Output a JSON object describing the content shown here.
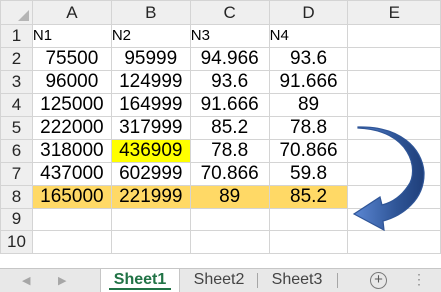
{
  "columns": [
    "A",
    "B",
    "C",
    "D",
    "E"
  ],
  "rows": [
    "1",
    "2",
    "3",
    "4",
    "5",
    "6",
    "7",
    "8",
    "9",
    "10"
  ],
  "headers": [
    "N1",
    "N2",
    "N3",
    "N4"
  ],
  "data": [
    [
      "75500",
      "95999",
      "94.966",
      "93.6"
    ],
    [
      "96000",
      "124999",
      "93.6",
      "91.666"
    ],
    [
      "125000",
      "164999",
      "91.666",
      "89"
    ],
    [
      "222000",
      "317999",
      "85.2",
      "78.8"
    ],
    [
      "318000",
      "436909",
      "78.8",
      "70.866"
    ],
    [
      "437000",
      "602999",
      "70.866",
      "59.8"
    ],
    [
      "165000",
      "221999",
      "89",
      "85.2"
    ]
  ],
  "highlights": {
    "yellow_cell": "B6",
    "orange_row": "8",
    "yellow_color": "#FFFF00",
    "orange_color": "#FFD966",
    "arrow_color": "#2F5597",
    "arrow_from_row": "5",
    "arrow_to_row": "8"
  },
  "sheet_tabs": [
    {
      "label": "Sheet1",
      "active": true
    },
    {
      "label": "Sheet2",
      "active": false
    },
    {
      "label": "Sheet3",
      "active": false
    }
  ],
  "add_sheet_label": "+",
  "more_label": "⋮"
}
